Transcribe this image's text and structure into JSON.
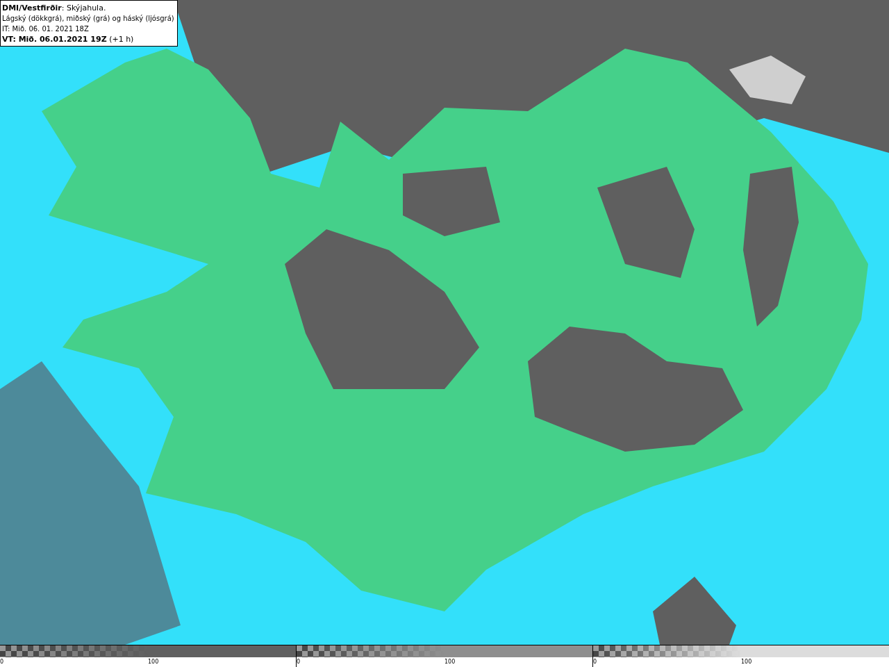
{
  "legend": {
    "title": "**DMI/Vestfirðir**: Skýjahula.",
    "description": "Lágský (dökkgrá), miðský (grá) og háský (ljósgrá)",
    "initial_time": "IT: Mið. 06. 01. 2021 18Z",
    "valid_time": "**VT: Mið. 06.01.2021 19Z** (+1 h)"
  },
  "colorbars": [
    {
      "kind": "low",
      "ticks": [
        "0",
        "100"
      ]
    },
    {
      "kind": "mid",
      "ticks": [
        "0",
        "100"
      ]
    },
    {
      "kind": "high",
      "ticks": [
        "0",
        "100"
      ]
    }
  ]
}
